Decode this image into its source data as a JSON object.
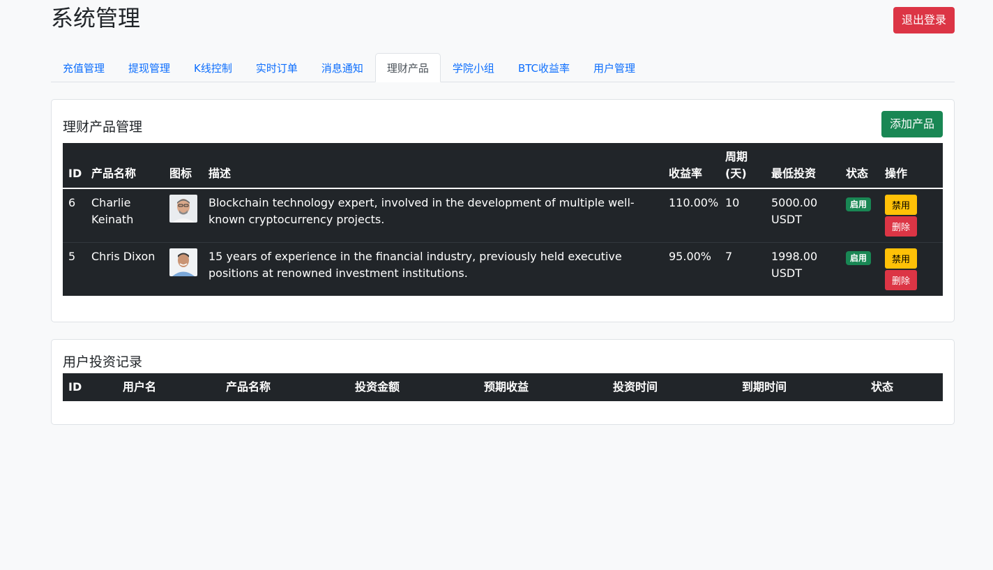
{
  "header": {
    "title": "系统管理",
    "logout_label": "退出登录"
  },
  "tabs": [
    {
      "label": "充值管理",
      "active": false
    },
    {
      "label": "提现管理",
      "active": false
    },
    {
      "label": "K线控制",
      "active": false
    },
    {
      "label": "实时订单",
      "active": false
    },
    {
      "label": "消息通知",
      "active": false
    },
    {
      "label": "理财产品",
      "active": true
    },
    {
      "label": "学院小组",
      "active": false
    },
    {
      "label": "BTC收益率",
      "active": false
    },
    {
      "label": "用户管理",
      "active": false
    }
  ],
  "products": {
    "title": "理财产品管理",
    "add_label": "添加产品",
    "columns": [
      "ID",
      "产品名称",
      "图标",
      "描述",
      "收益率",
      "周期\n(天)",
      "最低投资",
      "状态",
      "操作"
    ],
    "rows": [
      {
        "id": "6",
        "name": "Charlie Keinath",
        "icon": "avatar-icon",
        "description": "Blockchain technology expert, involved in the development of multiple well-known cryptocurrency projects.",
        "rate": "110.00%",
        "period": "10",
        "min_invest": "5000.00 USDT",
        "status": "启用",
        "disable_label": "禁用",
        "delete_label": "删除"
      },
      {
        "id": "5",
        "name": "Chris Dixon",
        "icon": "avatar-icon",
        "description": "15 years of experience in the financial industry, previously held executive positions at renowned investment institutions.",
        "rate": "95.00%",
        "period": "7",
        "min_invest": "1998.00 USDT",
        "status": "启用",
        "disable_label": "禁用",
        "delete_label": "删除"
      }
    ]
  },
  "investments": {
    "title": "用户投资记录",
    "columns": [
      "ID",
      "用户名",
      "产品名称",
      "投资金额",
      "预期收益",
      "投资时间",
      "到期时间",
      "状态"
    ]
  },
  "colors": {
    "danger": "#dc3545",
    "success": "#198754",
    "warning": "#ffc107",
    "primary": "#0d6efd",
    "table_dark": "#212529"
  }
}
